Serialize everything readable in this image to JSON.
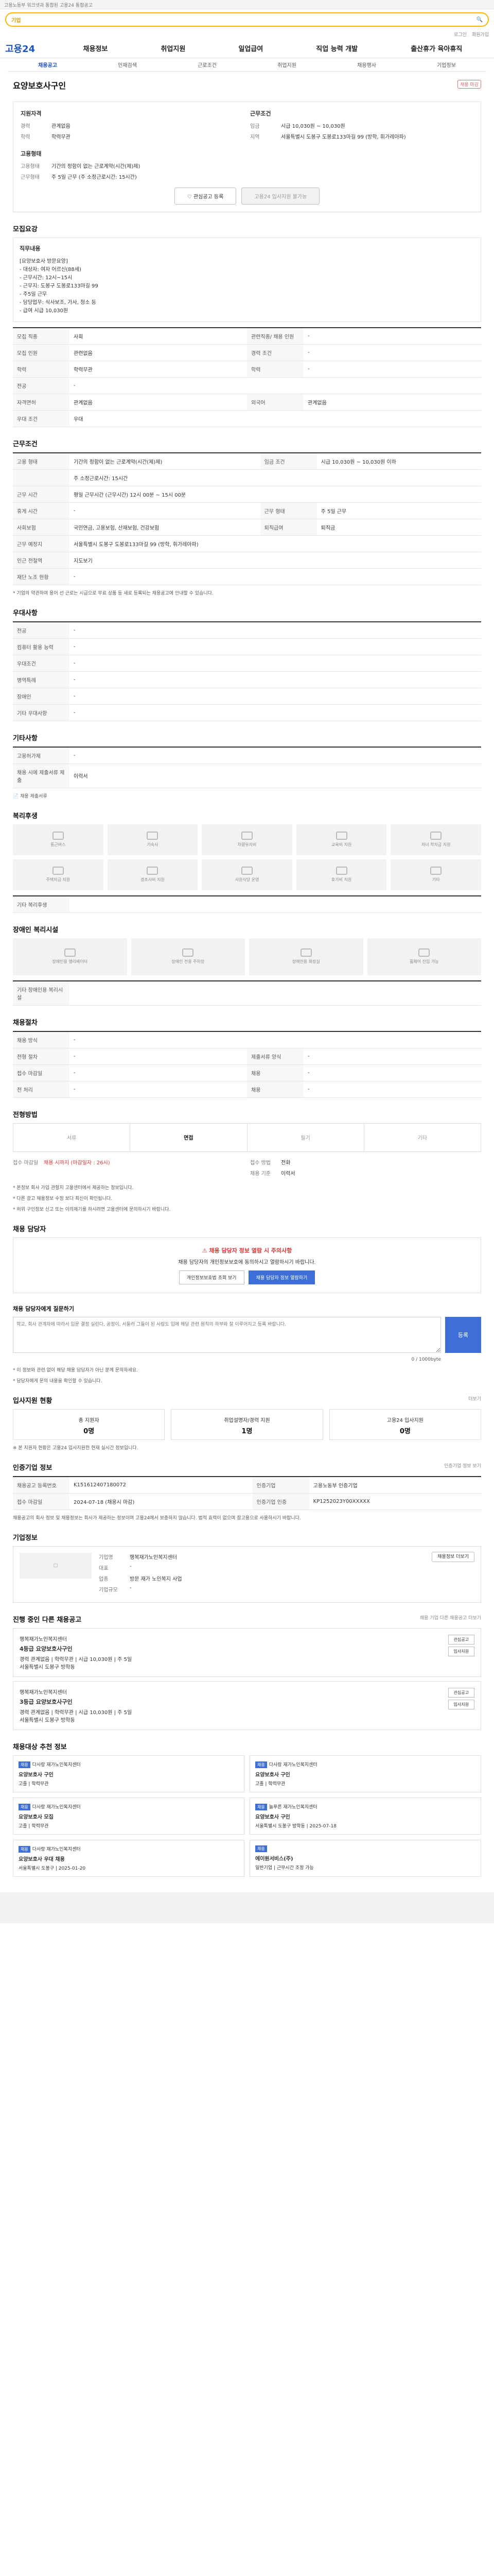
{
  "topbar": "고용노동부 워크넷과 통합된 고용24 통합공고",
  "search": {
    "label": "기업",
    "placeholder": ""
  },
  "util": [
    "로그인",
    "회원가입"
  ],
  "logo": "고용24",
  "gnb": [
    "채용정보",
    "취업지원",
    "일업급여",
    "직업 능력 개발",
    "출산휴가 육아휴직"
  ],
  "subnav": [
    "채용공고",
    "인재검색",
    "근로조건",
    "취업지원",
    "채용행사",
    "기업정보"
  ],
  "title": "요양보호사구인",
  "status_badge": "채용 마감",
  "summary": {
    "left_h": "지원자격",
    "left": [
      {
        "k": "경력",
        "v": "관계없음"
      },
      {
        "k": "학력",
        "v": "학력무관"
      }
    ],
    "right_h": "근무조건",
    "right": [
      {
        "k": "임금",
        "v": "시급 10,030원 ~ 10,030원"
      },
      {
        "k": "지역",
        "v": "서울특별시 도봉구 도봉로133마길 99 (방학, 휘가레아파)"
      }
    ],
    "left2_h": "고용형태",
    "left2": [
      {
        "k": "고용형태",
        "v": "기간의 정함이 없는 근로계약(시간(제)제)"
      },
      {
        "k": "근무형태",
        "v": "주 5일 근무 (주 소정근로시간: 15시간)"
      }
    ],
    "btn1": "관심공고 등록",
    "btn2": "고용24 입사지원 불가능"
  },
  "s1": {
    "h": "모집요강",
    "desc_h": "직무내용",
    "desc": [
      "[요양보호사 방문요양]",
      "- 대상자: 여자 어르신(88세)",
      "- 근무시간: 12시~15시",
      "- 근무지: 도봉구 도봉로133마길 99",
      "- 주5일 근무",
      "- 담당업무: 식사보조, 가사, 청소 등",
      "- 급여 시급 10,030원"
    ],
    "rows": [
      {
        "k": "모집 직종",
        "v": "사회",
        "k2": "관련직종/ 채용 인원",
        "v2": "-"
      },
      {
        "k": "모집 인원",
        "v": "관련없음",
        "k2": "경력 조건",
        "v2": "-"
      },
      {
        "k": "학력",
        "v": "학력무관",
        "k2": "학력",
        "v2": "-"
      },
      {
        "k": "전공",
        "v": "-",
        "k2": "",
        "v2": ""
      },
      {
        "k": "자격면허",
        "v": "관계없음",
        "k2": "외국어",
        "v2": "관계없음"
      },
      {
        "k": "우대 조건",
        "v": "우대",
        "k2": "",
        "v2": ""
      }
    ]
  },
  "s2": {
    "h": "근무조건",
    "rows": [
      {
        "k": "고용 형태",
        "v": "기간의 정함이 없는 근로계약(시간(제)제)",
        "k2": "임금 조건",
        "v2": "시급 10,030원 ~ 10,030원 이하"
      },
      {
        "k": "",
        "v": "주 소정근로시간: 15시간",
        "k2": "",
        "v2": ""
      },
      {
        "k": "근무 시간",
        "v": "평일 근무시간 (근무시간) 12시 00분 ~ 15시 00분",
        "k2": "",
        "v2": ""
      },
      {
        "k": "휴게 시간",
        "v": "-",
        "k2": "근무 형태",
        "v2": "주 5일 근무"
      },
      {
        "k": "사회보험",
        "v": "국민연금, 고용보험, 산재보험, 건강보험",
        "k2": "퇴직급여",
        "v2": "퇴직금"
      },
      {
        "k": "근무 예정지",
        "v": "서울특별시 도봉구 도봉로133마길 99 (방학, 휘가레아파)",
        "k2": "",
        "v2": ""
      },
      {
        "k": "인근 전철역",
        "v": "지도보기",
        "k2": "",
        "v2": ""
      },
      {
        "k": "재단 노조 현황",
        "v": "-",
        "k2": "",
        "v2": ""
      }
    ],
    "note": "* 기업의 약관하여 용어 선 근로는 시급으로 무료 상품 등 새로 등록되는 채용공고에 안내할 수 있습니다."
  },
  "s3": {
    "h": "우대사항",
    "rows": [
      {
        "k": "전공",
        "v": "-"
      },
      {
        "k": "컴퓨터 활용 능력",
        "v": "-"
      },
      {
        "k": "우대조건",
        "v": "-"
      },
      {
        "k": "병역특례",
        "v": "-"
      },
      {
        "k": "장애인",
        "v": "-"
      },
      {
        "k": "기타 우대사항",
        "v": "-"
      }
    ]
  },
  "s4": {
    "h": "기타사항",
    "rows": [
      {
        "k": "고용허가제",
        "v": "-"
      },
      {
        "k": "채용 시에 제출서류 제출",
        "v": "이력서"
      }
    ],
    "link": "채용 제출서류"
  },
  "s5": {
    "h": "복리후생",
    "items": [
      "통근버스",
      "기숙사",
      "차량유지비",
      "교육비 지원",
      "자녀 학자금 지원",
      "주택자금 지원",
      "경조사비 지원",
      "사원식당 운영",
      "휴가비 지원",
      "기타"
    ],
    "etc": "기타 복리후생"
  },
  "s6": {
    "h": "장애인 복리시설",
    "items": [
      "장애인용 엘리베이터",
      "장애인 전용 주차장",
      "장애인용 화장실",
      "휠체어 진입 가능"
    ],
    "etc": "기타 장애인용 복리시설"
  },
  "s7": {
    "h": "채용절차",
    "rows": [
      {
        "k": "채용 방식",
        "v": "-"
      },
      {
        "k": "전형 절차",
        "v": "-",
        "k2": "제출서류 양식",
        "v2": "-"
      },
      {
        "k": "접수 마감일",
        "v": "-",
        "k2": "채용",
        "v2": "-"
      },
      {
        "k": "전 처리",
        "v": "-",
        "k2": "채용",
        "v2": "-"
      }
    ]
  },
  "s8": {
    "h": "전형방법",
    "steps": [
      "서류",
      "면접",
      "필기",
      "기타"
    ],
    "left": [
      {
        "k": "접수 마감일",
        "v": "채용 시까지 (마감일자 : 26시)"
      }
    ],
    "right": [
      {
        "k": "접수 방법",
        "v": "전화"
      },
      {
        "k": "채용 기준",
        "v": "이력서"
      }
    ],
    "notes": [
      "* 본정보 회사 가입 관할지 고용센터에서 제공하는 정보입니다.",
      "* 다른 광고 채용정보 수정 보다 최신이 확인됩니다.",
      "* 허위 구인정보 신고 또는 이의제기를 하시려면 고용센터에 문의하시기 바랍니다."
    ]
  },
  "s9": {
    "h": "채용 담당자",
    "alert_red": "채용 담당자 정보 열람 시 주의사항",
    "alert": "채용 담당자의 개인정보보호에 동의하시고 열람하시기 바랍니다.",
    "b1": "개인정보보호법 조회 보기",
    "b2": "채용 담당자 정보 열람하기"
  },
  "s10": {
    "h": "채용 담당자에게 질문하기",
    "placeholder": "학교, 회사 관계자에 따라서 입문 결정 실린다, 공정이, 서둘러 그들이 된 사람도 입에 해당 관련 원칙의 하부와 잘 이루어지고 등록 바랍니다.",
    "go": "등록",
    "count": "0 / 1000byte",
    "n1": "* 이 정보와 관련 없이 해당 채용 담당자가 아닌 분께 문의하세요.",
    "n2": "* 담당자에게 문의 내용을 확인할 수 있습니다."
  },
  "s11": {
    "h": "입사지원 현황",
    "more": "더보기",
    "stats": [
      {
        "k": "총 지원자",
        "v": "0명"
      },
      {
        "k": "취업설명자/경력 지원",
        "v": "1명"
      },
      {
        "k": "고용24 입사지원",
        "v": "0명"
      }
    ],
    "note": "※ 본 지원자 현황은 고용24 입사지원한 현재 실시간 정보입니다."
  },
  "s12": {
    "h": "인증기업 정보",
    "more": "인증기업 정보 보기",
    "rows": [
      {
        "k": "채용공고 등록번호",
        "v": "K151612407180072",
        "k2": "인증기업",
        "v2": "고용노동부 인증기업"
      },
      {
        "k": "접수 마감일",
        "v": "2024-07-18 (채용시 마감)",
        "k2": "인증기업 인증",
        "v2": "KP1252023Y00XXXXX"
      }
    ],
    "note": "채용공고의 회사 정보 및 채용정보는 회사가 제공하는 정보이며 고용24에서 보증하지 않습니다. 법적 효력이 없으며 참고용으로 사용하시기 바랍니다."
  },
  "s13": {
    "h": "기업정보",
    "rows": [
      {
        "k": "기업명",
        "v": "행복재가노인복지센터"
      },
      {
        "k": "대표",
        "v": "-"
      },
      {
        "k": "업종",
        "v": "방문 재가 노인복지 사업"
      },
      {
        "k": "기업규모",
        "v": "-"
      }
    ],
    "btn": "채용정보 더보기"
  },
  "s14": {
    "h": "진행 중인 다른 채용공고",
    "more": "채용 기업 다른 채용공고 더보기",
    "jobs": [
      {
        "co": "행복재가노인복지센터",
        "t": "4등급 요양보호사구인",
        "info": "경력 관계없음 | 학력무관 | 시급 10,030원 | 주 5일",
        "loc": "서울특별시 도봉구 방학동",
        "s1": "관심공고",
        "s2": "입사지원"
      },
      {
        "co": "행복재가노인복지센터",
        "t": "3등급 요양보호사구인",
        "info": "경력 관계없음 | 학력무관 | 시급 10,030원 | 주 5일",
        "loc": "서울특별시 도봉구 방학동",
        "s1": "관심공고",
        "s2": "입사지원"
      }
    ]
  },
  "s15": {
    "h": "채용대상 추천 정보",
    "cards": [
      {
        "tag": "채용",
        "co": "다사랑 재가노인복지센터",
        "t": "요양보호사 구인",
        "info": "고졸 | 학력무관"
      },
      {
        "tag": "채용",
        "co": "다사랑 재가노인복지센터",
        "t": "요양보호사 구인",
        "info": "고졸 | 학력무관"
      },
      {
        "tag": "채용",
        "co": "다사랑 재가노인복지센터",
        "t": "요양보호사 모집",
        "info": "고졸 | 학력무관"
      },
      {
        "tag": "채용",
        "co": "늘푸른 재가노인복지센터",
        "t": "요양보호사 구인",
        "info": "서울특별시 도봉구 방학동 | 2025-07-18"
      },
      {
        "tag": "채용",
        "co": "다사랑 재가노인복지센터",
        "t": "요양보호사 우대 채용",
        "info": "서울특별시 도봉구 | 2025-01-20"
      },
      {
        "tag": "채용",
        "co": "",
        "t": "에이원서비스(주)",
        "info": "일반기업 | 근무시간 조정 가능"
      }
    ]
  }
}
